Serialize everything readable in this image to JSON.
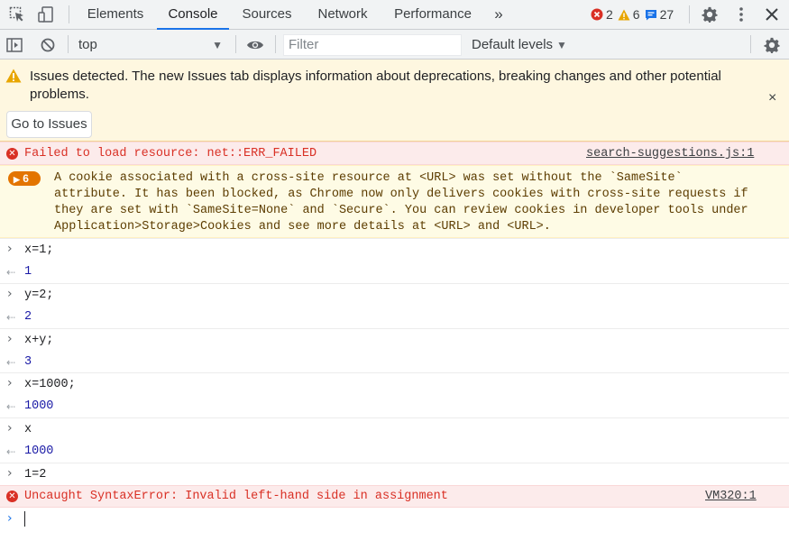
{
  "tabs": [
    {
      "label": "Elements"
    },
    {
      "label": "Console"
    },
    {
      "label": "Sources"
    },
    {
      "label": "Network"
    },
    {
      "label": "Performance"
    }
  ],
  "more_tabs": "»",
  "counts": {
    "errors": "2",
    "warnings": "6",
    "info": "27"
  },
  "toolbar": {
    "context": "top",
    "filter_placeholder": "Filter",
    "levels": "Default levels"
  },
  "banner": {
    "text": "Issues detected. The new Issues tab displays information about deprecations, breaking changes and other potential problems.",
    "button": "Go to Issues",
    "close": "×"
  },
  "messages": {
    "error1": {
      "text": "Failed to load resource: net::ERR_FAILED",
      "source": "search-suggestions.js:1"
    },
    "warning1": {
      "badge": "6",
      "lines": [
        "A cookie associated with a cross-site resource at <URL> was set without the `SameSite`",
        "attribute. It has been blocked, as Chrome now only delivers cookies with cross-site requests if",
        "they are set with `SameSite=None` and `Secure`. You can review cookies in developer tools under",
        "Application>Storage>Cookies and see more details at <URL> and <URL>."
      ]
    },
    "entries": [
      {
        "input": "x=1;",
        "result": "1"
      },
      {
        "input": "y=2;",
        "result": "2"
      },
      {
        "input": "x+y;",
        "result": "3"
      },
      {
        "input": "x=1000;",
        "result": "1000"
      },
      {
        "input": "x",
        "result": "1000"
      }
    ],
    "last_input": "1=2",
    "error2": {
      "text": "Uncaught SyntaxError: Invalid left-hand side in assignment",
      "source": "VM320:1"
    }
  },
  "colors": {
    "accent": "#1a73e8",
    "error": "#d93025",
    "warning": "#e37400",
    "result": "#1a1aa6",
    "banner_bg": "#fef7e0"
  }
}
